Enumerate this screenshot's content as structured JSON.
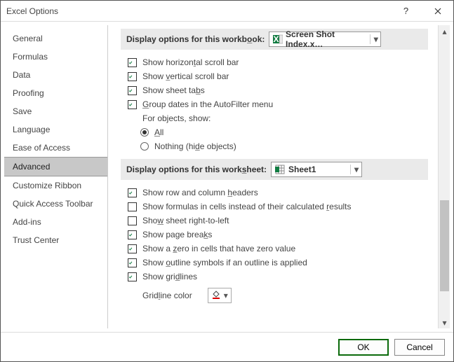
{
  "titlebar": {
    "title": "Excel Options"
  },
  "sidebar": {
    "items": [
      {
        "label": "General"
      },
      {
        "label": "Formulas"
      },
      {
        "label": "Data"
      },
      {
        "label": "Proofing"
      },
      {
        "label": "Save"
      },
      {
        "label": "Language"
      },
      {
        "label": "Ease of Access"
      },
      {
        "label": "Advanced"
      },
      {
        "label": "Customize Ribbon"
      },
      {
        "label": "Quick Access Toolbar"
      },
      {
        "label": "Add-ins"
      },
      {
        "label": "Trust Center"
      }
    ],
    "selected_index": 7
  },
  "section_workbook": {
    "heading_prefix": "Display options for this workb",
    "heading_u": "o",
    "heading_suffix": "ok:",
    "dropdown_value": "Screen Shot Index.x…"
  },
  "workbook_opts": {
    "hscroll": {
      "pre": "Show horizon",
      "u": "t",
      "post": "al scroll bar"
    },
    "vscroll": {
      "pre": "Show ",
      "u": "v",
      "post": "ertical scroll bar"
    },
    "tabs": {
      "pre": "Show sheet ta",
      "u": "b",
      "post": "s"
    },
    "group": {
      "pre": "",
      "u": "G",
      "post": "roup dates in the AutoFilter menu"
    },
    "objects_label": "For objects, show:",
    "radio_all": {
      "pre": "",
      "u": "A",
      "post": "ll"
    },
    "radio_nothing": {
      "pre": "Nothing (hi",
      "u": "d",
      "post": "e objects)"
    }
  },
  "section_worksheet": {
    "heading_prefix": "Display options for this work",
    "heading_u": "s",
    "heading_suffix": "heet:",
    "dropdown_value": "Sheet1"
  },
  "sheet_opts": {
    "headers": {
      "pre": "Show row and column ",
      "u": "h",
      "post": "eaders"
    },
    "formulas": {
      "pre": "Show formulas in cells instead of their calculated ",
      "u": "r",
      "post": "esults"
    },
    "rtl": {
      "pre": "Sho",
      "u": "w",
      "post": " sheet right-to-left"
    },
    "pagebreaks": {
      "pre": "Show page brea",
      "u": "k",
      "post": "s"
    },
    "zero": {
      "pre": "Show a ",
      "u": "z",
      "post": "ero in cells that have zero value"
    },
    "outline": {
      "pre": "Show ",
      "u": "o",
      "post": "utline symbols if an outline is applied"
    },
    "gridlines": {
      "pre": "Show gri",
      "u": "d",
      "post": "lines"
    },
    "gridcolor_label": {
      "pre": "Grid",
      "u": "l",
      "post": "ine color"
    }
  },
  "footer": {
    "ok": "OK",
    "cancel": "Cancel"
  }
}
